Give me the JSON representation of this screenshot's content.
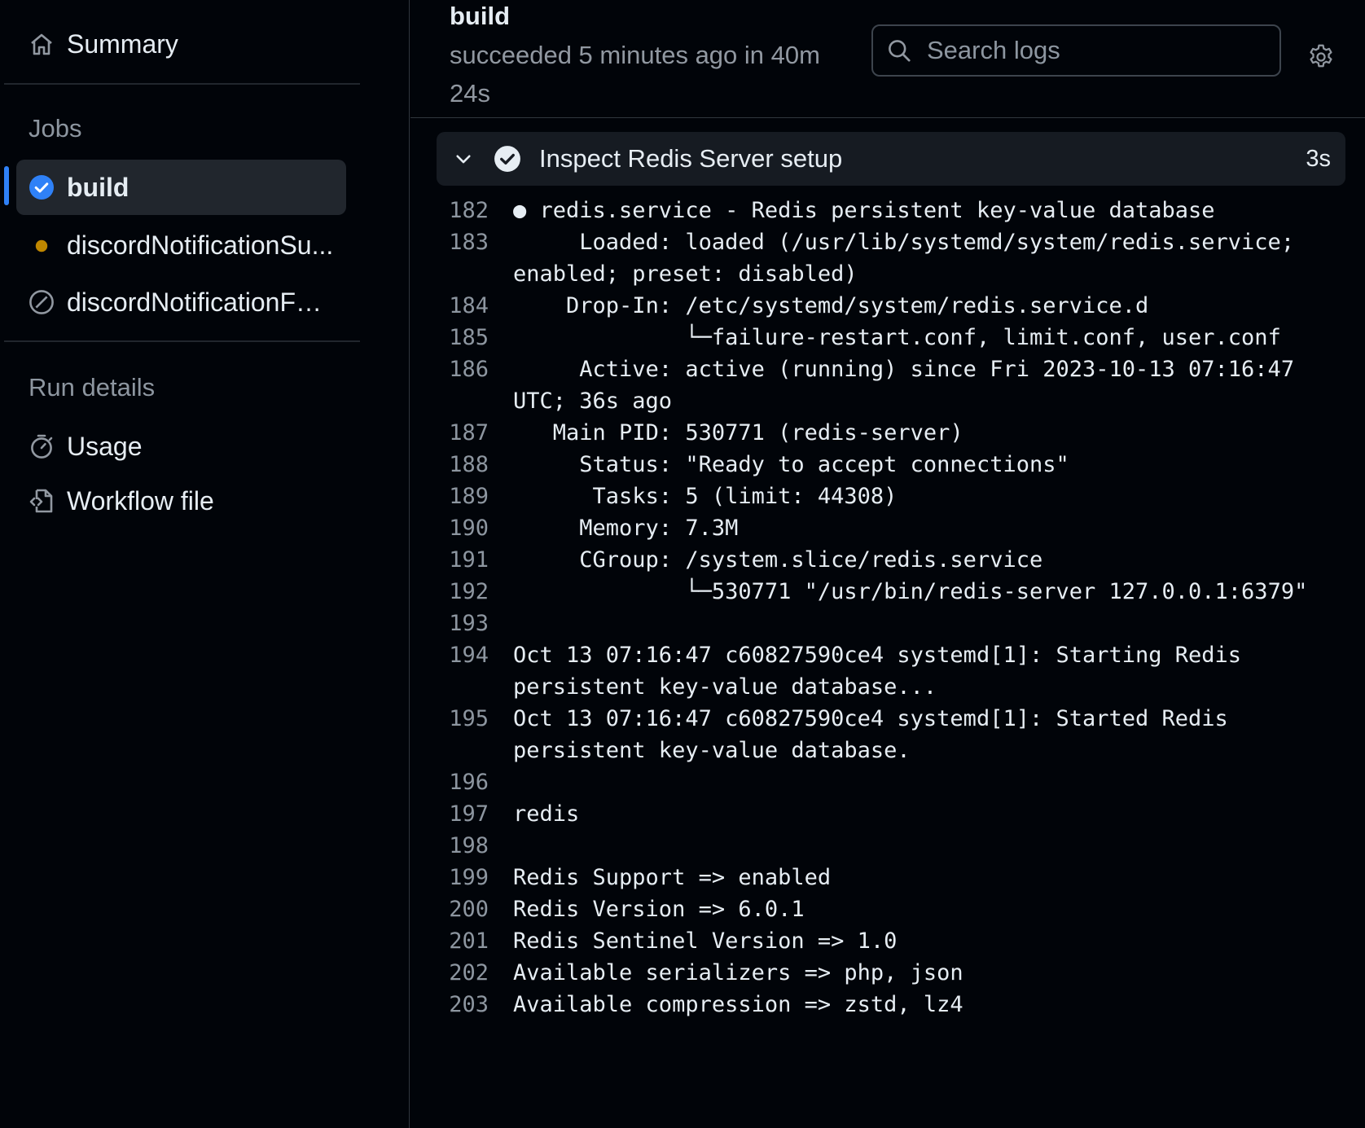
{
  "sidebar": {
    "summary_label": "Summary",
    "jobs_heading": "Jobs",
    "jobs": [
      {
        "label": "build",
        "status": "success"
      },
      {
        "label": "discordNotificationSu...",
        "status": "in-progress"
      },
      {
        "label": "discordNotificationFai...",
        "status": "skipped"
      }
    ],
    "run_details_heading": "Run details",
    "run_details": [
      {
        "label": "Usage",
        "icon": "stopwatch-icon"
      },
      {
        "label": "Workflow file",
        "icon": "file-code-icon"
      }
    ]
  },
  "header": {
    "job_title": "build",
    "job_status": "succeeded 5 minutes ago in 40m 24s",
    "search_placeholder": "Search logs"
  },
  "step": {
    "name": "Inspect Redis Server setup",
    "duration": "3s"
  },
  "log_lines": [
    {
      "num": "182",
      "text": "● redis.service - Redis persistent key-value database"
    },
    {
      "num": "183",
      "text": "     Loaded: loaded (/usr/lib/systemd/system/redis.service; enabled; preset: disabled)"
    },
    {
      "num": "184",
      "text": "    Drop-In: /etc/systemd/system/redis.service.d"
    },
    {
      "num": "185",
      "text": "             └─failure-restart.conf, limit.conf, user.conf"
    },
    {
      "num": "186",
      "text": "     Active: active (running) since Fri 2023-10-13 07:16:47 UTC; 36s ago"
    },
    {
      "num": "187",
      "text": "   Main PID: 530771 (redis-server)"
    },
    {
      "num": "188",
      "text": "     Status: \"Ready to accept connections\""
    },
    {
      "num": "189",
      "text": "      Tasks: 5 (limit: 44308)"
    },
    {
      "num": "190",
      "text": "     Memory: 7.3M"
    },
    {
      "num": "191",
      "text": "     CGroup: /system.slice/redis.service"
    },
    {
      "num": "192",
      "text": "             └─530771 \"/usr/bin/redis-server 127.0.0.1:6379\""
    },
    {
      "num": "193",
      "text": ""
    },
    {
      "num": "194",
      "text": "Oct 13 07:16:47 c60827590ce4 systemd[1]: Starting Redis persistent key-value database..."
    },
    {
      "num": "195",
      "text": "Oct 13 07:16:47 c60827590ce4 systemd[1]: Started Redis persistent key-value database."
    },
    {
      "num": "196",
      "text": ""
    },
    {
      "num": "197",
      "text": "redis"
    },
    {
      "num": "198",
      "text": ""
    },
    {
      "num": "199",
      "text": "Redis Support => enabled"
    },
    {
      "num": "200",
      "text": "Redis Version => 6.0.1"
    },
    {
      "num": "201",
      "text": "Redis Sentinel Version => 1.0"
    },
    {
      "num": "202",
      "text": "Available serializers => php, json"
    },
    {
      "num": "203",
      "text": "Available compression => zstd, lz4"
    }
  ],
  "colors": {
    "accent": "#2f81f7",
    "success": "#2f81f7",
    "in_progress": "#bf8700",
    "background": "#010409"
  }
}
